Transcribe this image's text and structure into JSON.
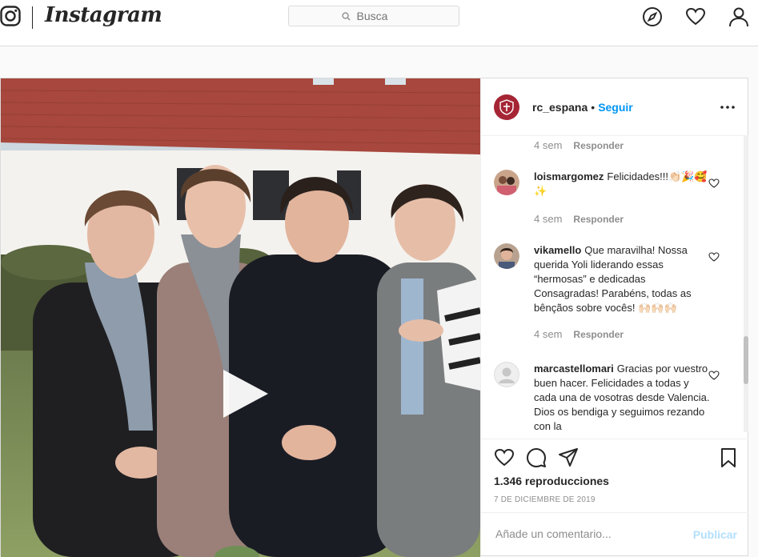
{
  "topbar": {
    "wordmark": "Instagram",
    "search_placeholder": "Busca",
    "icons": [
      "camera-logo-icon",
      "compass-icon",
      "heart-icon",
      "user-icon"
    ]
  },
  "post": {
    "username": "rc_espana",
    "separator": "•",
    "follow_label": "Seguir",
    "more_icon": "ellipsis-icon",
    "comments": [
      {
        "user": "",
        "text": "",
        "time": "4 sem",
        "reply": "Responder"
      },
      {
        "user": "loismargomez",
        "text": "Felicidades!!!👏🏻🎉🥰✨",
        "time": "4 sem",
        "reply": "Responder"
      },
      {
        "user": "vikamello",
        "text": "Que maravilha! Nossa querida Yoli liderando essas “hermosas” e dedicadas Consagradas! Parabéns, todas as bênçãos sobre vocês! 🙌🏻🙌🏻🙌🏻",
        "time": "4 sem",
        "reply": "Responder"
      },
      {
        "user": "marcastellomari",
        "text": "Gracias por vuestro buen hacer. Felicidades a todas y cada una de vosotras desde Valencia. Dios os bendiga y seguimos rezando con la",
        "time": "",
        "reply": ""
      }
    ],
    "views": "1.346 reproducciones",
    "date": "7 DE DICIEMBRE DE 2019",
    "comment_placeholder": "Añade un comentario...",
    "publish_label": "Publicar"
  },
  "colors": {
    "link_blue": "#0095f6",
    "publish_disabled": "#b2dffc",
    "avatar_red": "#a52534",
    "muted": "#8e8e8e"
  }
}
